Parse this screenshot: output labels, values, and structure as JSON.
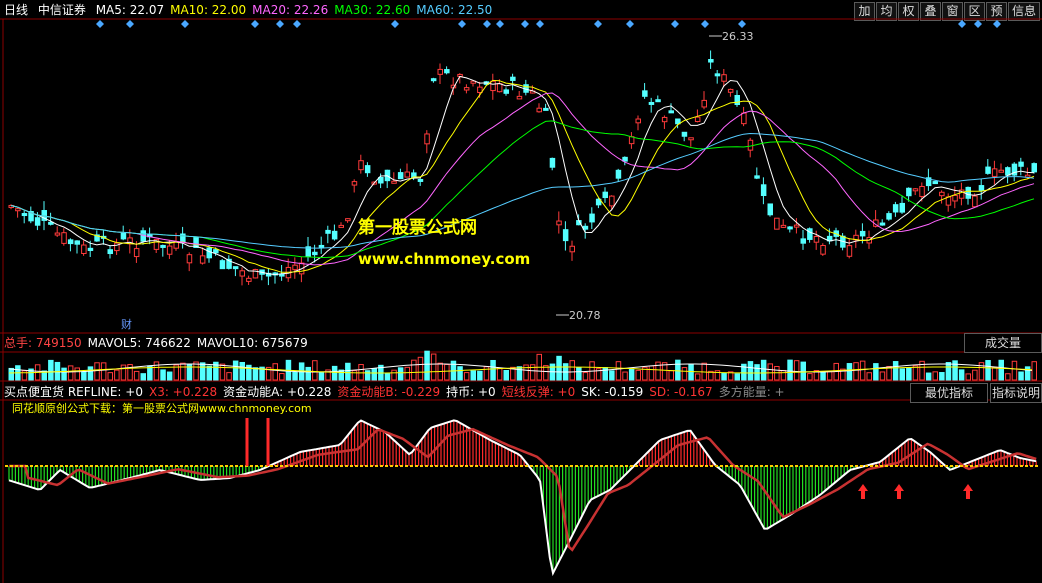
{
  "header": {
    "period": "日线",
    "stock_name": "中信证券",
    "ma": [
      {
        "label": "MA5: 22.07",
        "color": "#ffffff"
      },
      {
        "label": "MA10: 22.00",
        "color": "#ffff00"
      },
      {
        "label": "MA20: 22.26",
        "color": "#ff66ff"
      },
      {
        "label": "MA30: 22.60",
        "color": "#00ff00"
      },
      {
        "label": "MA60: 22.50",
        "color": "#55ccff"
      }
    ]
  },
  "toolbar": {
    "buttons": [
      "加",
      "均",
      "权",
      "叠",
      "窗",
      "区",
      "预",
      "信息"
    ]
  },
  "price_chart": {
    "high_label": "26.33",
    "low_label": "20.78",
    "event_marker": "财",
    "watermark_cn": "第一股票公式网",
    "watermark_url": "www.chnmoney.com"
  },
  "volume_panel": {
    "items": [
      {
        "label": "总手: 749150",
        "color": "#ff4444"
      },
      {
        "label": "MAVOL5: 746622",
        "color": "#ffffff"
      },
      {
        "label": "MAVOL10: 675679",
        "color": "#ffffff"
      }
    ],
    "button": "成交量"
  },
  "indicator_panel": {
    "items": [
      {
        "label": "买点便宜货 REFLINE: +0",
        "color": "#ffffff"
      },
      {
        "label": "X3: +0.228",
        "color": "#ff3333"
      },
      {
        "label": "资金动能A: +0.228",
        "color": "#ffffff"
      },
      {
        "label": "资金动能B: -0.229",
        "color": "#ff3333"
      },
      {
        "label": "持币: +0",
        "color": "#ffffff"
      },
      {
        "label": "短线反弹: +0",
        "color": "#ff3333"
      },
      {
        "label": "SK: -0.159",
        "color": "#ffffff"
      },
      {
        "label": "SD: -0.167",
        "color": "#ff3333"
      },
      {
        "label": "多方能量: +",
        "color": "#888888"
      }
    ],
    "btn_best": "最优指标",
    "btn_help": "指标说明",
    "promo": "同花顺原创公式下载：第一股票公式网www.chnmoney.com"
  },
  "colors": {
    "up": "#ff3b3b",
    "down": "#54ffff",
    "grid": "#8b0000"
  }
}
